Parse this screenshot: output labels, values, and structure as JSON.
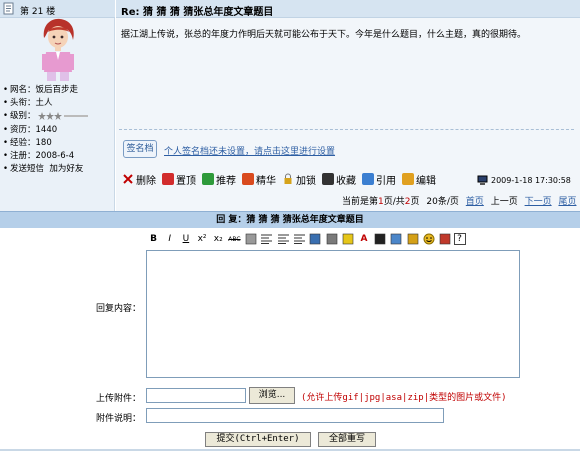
{
  "post": {
    "floor_prefix": "第",
    "floor_number": "21",
    "floor_suffix": "楼",
    "title": "Re: 猜 猜 猜 猜张总年度文章题目",
    "body": "据江湖上传说，张总的年度力作明后天就可能公布于天下。今年是什么题目，什么主题，真的很期待。",
    "signature_button": "签名档",
    "signature_link": "个人签名档还未设置，请点击这里进行设置",
    "time": "2009-1-18 17:30:58"
  },
  "user": {
    "nickname_label": "网名：",
    "nickname": "饭后百步走",
    "title_label": "头衔：",
    "title": "土人",
    "level_label": "级别：",
    "level_stars": 3,
    "resource_label": "资历：",
    "resource": "1440",
    "exp_label": "经验：",
    "exp": "180",
    "register_label": "注册：",
    "register": "2008-6-4",
    "send_msg": "发送短信",
    "add_friend": "加为好友"
  },
  "actions": [
    {
      "label": "删除",
      "icon": "delete-icon",
      "color": "#c00000"
    },
    {
      "label": "置顶",
      "icon": "pin-top-icon",
      "color": "#d22c2c"
    },
    {
      "label": "推荐",
      "icon": "recommend-icon",
      "color": "#2e9a3a"
    },
    {
      "label": "精华",
      "icon": "essence-icon",
      "color": "#d94a1e"
    },
    {
      "label": "加锁",
      "icon": "lock-icon",
      "color": "#d6a31a"
    },
    {
      "label": "收藏",
      "icon": "favorite-icon",
      "color": "#333333"
    },
    {
      "label": "引用",
      "icon": "quote-icon",
      "color": "#3b7fd1"
    },
    {
      "label": "编辑",
      "icon": "edit-icon",
      "color": "#e0a020"
    }
  ],
  "pager": {
    "prefix": "当前是第",
    "current": "1",
    "mid": "页/共",
    "total": "2",
    "suffix": "页",
    "per_page": "20条/页",
    "first": "首页",
    "prev": "上一页",
    "next": "下一页",
    "last": "尾页"
  },
  "reply": {
    "header": "回 复：猜 猜 猜 猜张总年度文章题目",
    "content_label": "回复内容：",
    "upload_label": "上传附件：",
    "browse_button": "浏览...",
    "upload_hint": "(允许上传gif|jpg|asa|zip|类型的图片或文件)",
    "desc_label": "附件说明：",
    "submit_button": "提交(Ctrl+Enter)",
    "reset_button": "全部重写"
  },
  "toolbar": [
    {
      "label": "B",
      "icon": "bold-icon"
    },
    {
      "label": "I",
      "icon": "italic-icon"
    },
    {
      "label": "U",
      "icon": "underline-icon"
    },
    {
      "label": "x²",
      "icon": "superscript-icon"
    },
    {
      "label": "x₂",
      "icon": "subscript-icon"
    },
    {
      "label": "ABC",
      "icon": "strikethrough-icon"
    },
    {
      "label": "",
      "icon": "eraser-icon"
    },
    {
      "label": "",
      "icon": "align-left-icon"
    },
    {
      "label": "",
      "icon": "align-center-icon"
    },
    {
      "label": "",
      "icon": "align-right-icon"
    },
    {
      "label": "",
      "icon": "hyperlink-icon"
    },
    {
      "label": "",
      "icon": "unlink-icon"
    },
    {
      "label": "",
      "icon": "highlight-icon"
    },
    {
      "label": "A",
      "icon": "font-color-icon"
    },
    {
      "label": "",
      "icon": "find-icon"
    },
    {
      "label": "",
      "icon": "image-icon"
    },
    {
      "label": "",
      "icon": "media-icon"
    },
    {
      "label": "",
      "icon": "emoticon-icon"
    },
    {
      "label": "",
      "icon": "flash-icon"
    },
    {
      "label": "?",
      "icon": "help-icon"
    }
  ]
}
